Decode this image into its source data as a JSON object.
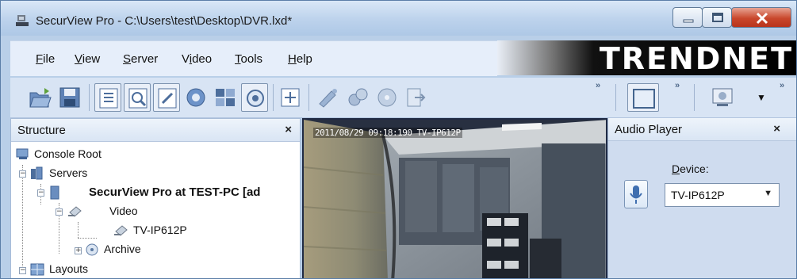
{
  "window": {
    "title": "SecurView Pro - C:\\Users\\test\\Desktop\\DVR.lxd*"
  },
  "menu": {
    "items": [
      {
        "label": "File",
        "mnemonic_index": 0
      },
      {
        "label": "View",
        "mnemonic_index": 0
      },
      {
        "label": "Server",
        "mnemonic_index": 0
      },
      {
        "label": "Video",
        "mnemonic_index": 1
      },
      {
        "label": "Tools",
        "mnemonic_index": 0
      },
      {
        "label": "Help",
        "mnemonic_index": 0
      }
    ]
  },
  "brand": {
    "logo": "TRENDnet"
  },
  "toolbar": {
    "buttons": [
      {
        "icon": "open-icon"
      },
      {
        "icon": "save-icon"
      },
      {
        "icon": "structure-view-icon",
        "pressed": true
      },
      {
        "icon": "zoom-view-icon",
        "pressed": true
      },
      {
        "icon": "properties-icon",
        "pressed": true
      },
      {
        "icon": "globe-icon"
      },
      {
        "icon": "layout-grid-icon"
      },
      {
        "icon": "camera-view-icon",
        "pressed": true
      },
      {
        "icon": "fullscreen-icon"
      },
      {
        "icon": "ptz-icon"
      },
      {
        "icon": "snapshot-icon"
      },
      {
        "icon": "disc-icon"
      },
      {
        "icon": "export-icon"
      }
    ],
    "overflow_glyph": "»",
    "dropdown_glyph": "▼"
  },
  "structure_panel": {
    "title": "Structure",
    "close_glyph": "×",
    "tree": [
      {
        "label": "Console Root",
        "icon": "console-root-icon"
      },
      {
        "label": "Servers",
        "icon": "servers-icon"
      },
      {
        "label": "SecurView Pro at TEST-PC [ad",
        "icon": "server-icon",
        "bold": true
      },
      {
        "label": "Video",
        "icon": "video-folder-icon"
      },
      {
        "label": "TV-IP612P",
        "icon": "camera-device-icon"
      },
      {
        "label": "Archive",
        "icon": "archive-icon"
      },
      {
        "label": "Layouts",
        "icon": "layouts-icon"
      }
    ]
  },
  "video_panel": {
    "osd_text": "2011/08/29 09:18:190 TV-IP612P"
  },
  "audio_panel": {
    "title": "Audio Player",
    "close_glyph": "×",
    "device_label": "Device:",
    "device_mnemonic_index": 0,
    "device_value": "TV-IP612P",
    "dropdown_glyph": "▼"
  }
}
